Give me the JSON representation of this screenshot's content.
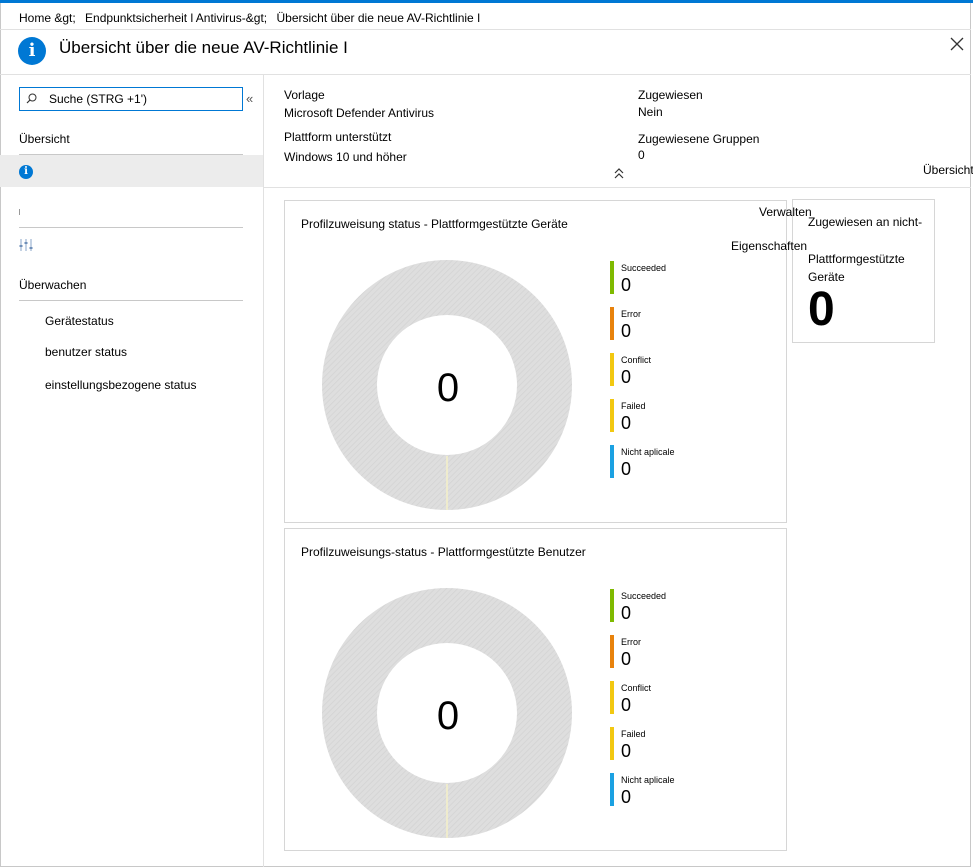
{
  "breadcrumb": [
    "Home &gt;",
    "Endpunktsicherheit l Antivirus-&gt;",
    "Übersicht über die neue AV-Richtlinie I"
  ],
  "header": {
    "title": "Übersicht über die neue AV-Richtlinie I",
    "icon": "info-icon"
  },
  "sidebar": {
    "search_placeholder": "Suche (STRG +1')",
    "overview_label": "Übersicht",
    "monitor_label": "Überwachen",
    "monitor_items": [
      "Gerätestatus",
      "benutzer status",
      "einstellungsbezogene status"
    ]
  },
  "summary": {
    "template_label": "Vorlage",
    "template_value": "Microsoft Defender Antivirus",
    "platform_label": "Plattform unterstützt",
    "platform_value": "Windows 10 und höher",
    "assigned_label": "Zugewiesen",
    "assigned_value": "Nein",
    "groups_label": "Zugewiesene Gruppen",
    "groups_value": "0",
    "overview_cut": "Übersicht"
  },
  "actions": {
    "manage": "Verwalten",
    "properties": "Eigenschaften"
  },
  "charts": [
    {
      "title": "Profilzuweisung status - Plattformgestützte Geräte",
      "center_value": "0",
      "legend": [
        {
          "label": "Succeeded",
          "value": "0",
          "color": "#7fba00"
        },
        {
          "label": "Error",
          "value": "0",
          "color": "#e8820c"
        },
        {
          "label": "Conflict",
          "value": "0",
          "color": "#f2c811"
        },
        {
          "label": "Failed",
          "value": "0",
          "color": "#f2c811"
        },
        {
          "label": "Nicht aplicale",
          "value": "0",
          "color": "#1ba1e2"
        }
      ]
    },
    {
      "title": "Profilzuweisungs-status - Plattformgestützte Benutzer",
      "center_value": "0",
      "legend": [
        {
          "label": "Succeeded",
          "value": "0",
          "color": "#7fba00"
        },
        {
          "label": "Error",
          "value": "0",
          "color": "#e8820c"
        },
        {
          "label": "Conflict",
          "value": "0",
          "color": "#f2c811"
        },
        {
          "label": "Failed",
          "value": "0",
          "color": "#f2c811"
        },
        {
          "label": "Nicht aplicale",
          "value": "0",
          "color": "#1ba1e2"
        }
      ]
    }
  ],
  "tile": {
    "lines": [
      "Zugewiesen an nicht-",
      "Plattformgestützte",
      "Geräte"
    ],
    "value": "0"
  }
}
